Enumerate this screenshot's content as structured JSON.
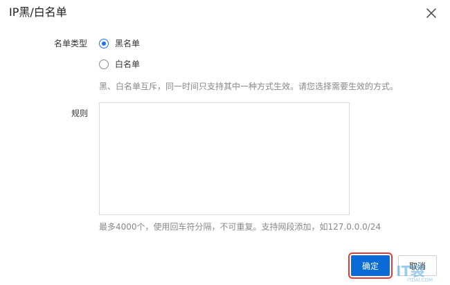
{
  "dialog": {
    "title": "IP黑/白名单",
    "close_icon": "close-icon"
  },
  "form": {
    "list_type_label": "名单类型",
    "options": [
      {
        "label": "黑名单",
        "checked": true
      },
      {
        "label": "白名单",
        "checked": false
      }
    ],
    "list_type_hint": "黑、白名单互斥，同一时间只支持其中一种方式生效。请您选择需要生效的方式。",
    "rules_label": "规则",
    "rules_value": "",
    "rules_hint": "最多4000个，使用回车符分隔，不可重复。支持网段添加，如127.0.0.0/24"
  },
  "footer": {
    "confirm_label": "确定",
    "cancel_label": "取消"
  },
  "watermark": {
    "logo_text": "IT袋",
    "sub_text": "ITDAI.COM"
  },
  "colors": {
    "primary": "#0a6bd6",
    "highlight": "#e53935"
  }
}
